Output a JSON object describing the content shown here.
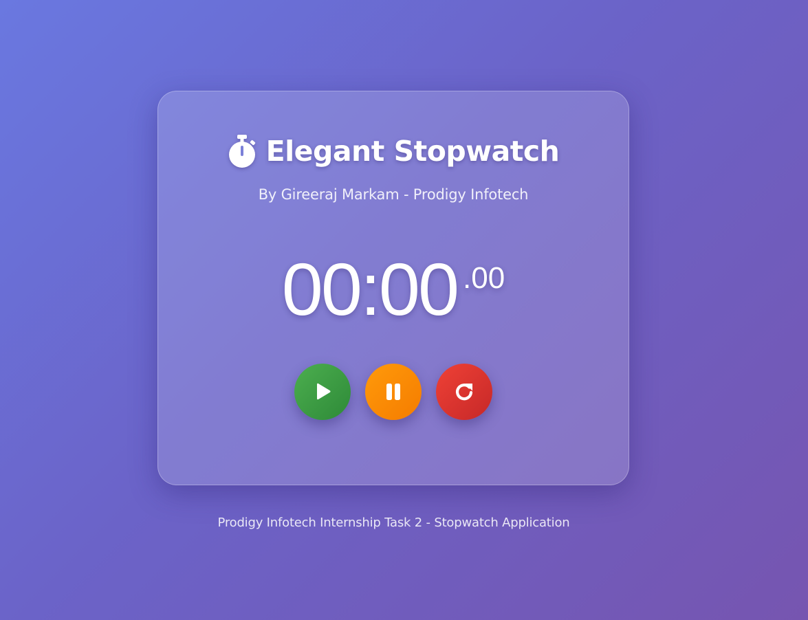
{
  "app": {
    "title": "Elegant Stopwatch",
    "subtitle": "By Gireeraj Markam - Prodigy Infotech",
    "title_icon": "stopwatch-icon"
  },
  "display": {
    "time": "00:00",
    "milliseconds": ".00"
  },
  "controls": [
    {
      "name": "start",
      "icon": "play-icon",
      "color": "#43a047"
    },
    {
      "name": "pause",
      "icon": "pause-icon",
      "color": "#fb8c00"
    },
    {
      "name": "reset",
      "icon": "refresh-icon",
      "color": "#e53935"
    }
  ],
  "footer": {
    "text": "Prodigy Infotech Internship Task 2 - Stopwatch Application"
  },
  "theme": {
    "background_start": "#6a78e0",
    "background_end": "#7655b0"
  }
}
